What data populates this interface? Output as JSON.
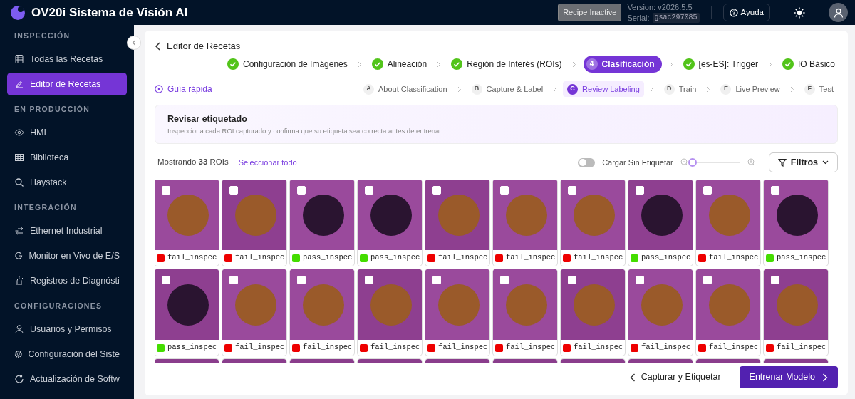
{
  "header": {
    "title": "OV20i Sistema de Visión AI",
    "recipe_status": "Recipe Inactive",
    "version": "Version: v2026.5.5",
    "serial_label": "Serial:",
    "serial": "gsac297085",
    "help": "Ayuda"
  },
  "sidebar": {
    "sections": [
      {
        "title": "INSPECCIÓN",
        "items": [
          {
            "label": "Todas las Recetas",
            "selected": false
          },
          {
            "label": "Editor de Recetas",
            "selected": true
          }
        ]
      },
      {
        "title": "EN PRODUCCIÓN",
        "items": [
          {
            "label": "HMI",
            "selected": false
          },
          {
            "label": "Biblioteca",
            "selected": false
          },
          {
            "label": "Haystack",
            "selected": false
          }
        ]
      },
      {
        "title": "INTEGRACIÓN",
        "items": [
          {
            "label": "Ethernet Industrial",
            "selected": false
          },
          {
            "label": "Monitor en Vivo de E/S",
            "selected": false
          },
          {
            "label": "Registros de Diagnósti",
            "selected": false
          }
        ]
      },
      {
        "title": "CONFIGURACIONES",
        "items": [
          {
            "label": "Usuarios y Permisos",
            "selected": false
          },
          {
            "label": "Configuración del Siste",
            "selected": false
          },
          {
            "label": "Actualización de Softw",
            "selected": false
          }
        ]
      }
    ]
  },
  "page": {
    "back": "Editor de Recetas",
    "steps": [
      {
        "label": "Configuración de Imágenes",
        "done": true,
        "selected": false
      },
      {
        "label": "Alineación",
        "done": true,
        "selected": false
      },
      {
        "label": "Región de Interés (ROIs)",
        "done": true,
        "selected": false
      },
      {
        "label": "Clasificación",
        "number": "4",
        "done": false,
        "selected": true
      },
      {
        "label": "[es-ES]: Trigger",
        "done": true,
        "selected": false
      },
      {
        "label": "IO Básico",
        "done": true,
        "selected": false
      }
    ],
    "guide": "Guía rápida",
    "substeps": [
      {
        "letter": "A",
        "label": "About Classification",
        "selected": false
      },
      {
        "letter": "B",
        "label": "Capture & Label",
        "selected": false
      },
      {
        "letter": "C",
        "label": "Review Labeling",
        "selected": true
      },
      {
        "letter": "D",
        "label": "Train",
        "selected": false
      },
      {
        "letter": "E",
        "label": "Live Preview",
        "selected": false
      },
      {
        "letter": "F",
        "label": "Test",
        "selected": false
      }
    ],
    "panel": {
      "title": "Revisar etiquetado",
      "description": "Inspecciona cada ROI capturado y confirma que su etiqueta sea correcta antes de entrenar"
    },
    "toolbar": {
      "count": "Mostrando **33** ROIs",
      "select_all": "Seleccionar todo",
      "toggle": {
        "label": "Cargar Sin Etiquetar",
        "on": false
      },
      "zoom": {
        "level": 0.05
      },
      "filters": "Filtros"
    },
    "tiles": [
      {
        "label": "fail_inspec",
        "color": "#ee0000",
        "checked": false
      },
      {
        "label": "fail_inspec",
        "color": "#ee0000",
        "checked": false
      },
      {
        "label": "pass_inspec",
        "color": "#44dd00",
        "checked": false
      },
      {
        "label": "pass_inspec",
        "color": "#44dd00",
        "checked": false
      },
      {
        "label": "fail_inspec",
        "color": "#ee0000",
        "checked": false
      },
      {
        "label": "fail_inspec",
        "color": "#ee0000",
        "checked": false
      },
      {
        "label": "fail_inspec",
        "color": "#ee0000",
        "checked": false
      },
      {
        "label": "pass_inspec",
        "color": "#44dd00",
        "checked": false
      },
      {
        "label": "fail_inspec",
        "color": "#ee0000",
        "checked": false
      },
      {
        "label": "pass_inspec",
        "color": "#44dd00",
        "checked": false
      },
      {
        "label": "pass_inspec",
        "color": "#44dd00",
        "checked": false
      },
      {
        "label": "fail_inspec",
        "color": "#ee0000",
        "checked": false
      },
      {
        "label": "fail_inspec",
        "color": "#ee0000",
        "checked": false
      },
      {
        "label": "fail_inspec",
        "color": "#ee0000",
        "checked": false
      },
      {
        "label": "fail_inspec",
        "color": "#ee0000",
        "checked": false
      },
      {
        "label": "fail_inspec",
        "color": "#ee0000",
        "checked": false
      },
      {
        "label": "fail_inspec",
        "color": "#ee0000",
        "checked": false
      },
      {
        "label": "fail_inspec",
        "color": "#ee0000",
        "checked": false
      },
      {
        "label": "fail_inspec",
        "color": "#ee0000",
        "checked": false
      },
      {
        "label": "fail_inspec",
        "color": "#ee0000",
        "checked": false
      }
    ],
    "partial_tiles": [
      {
        "kind": "image"
      },
      {
        "kind": "image"
      },
      {
        "kind": "image"
      },
      {
        "kind": "image"
      },
      {
        "kind": "image"
      },
      {
        "kind": "image"
      },
      {
        "kind": "image"
      },
      {
        "kind": "image"
      },
      {
        "kind": "image"
      },
      {
        "kind": "image"
      }
    ],
    "footer": {
      "back": "Capturar y Etiquetar",
      "next": "Entrenar Modelo"
    }
  }
}
